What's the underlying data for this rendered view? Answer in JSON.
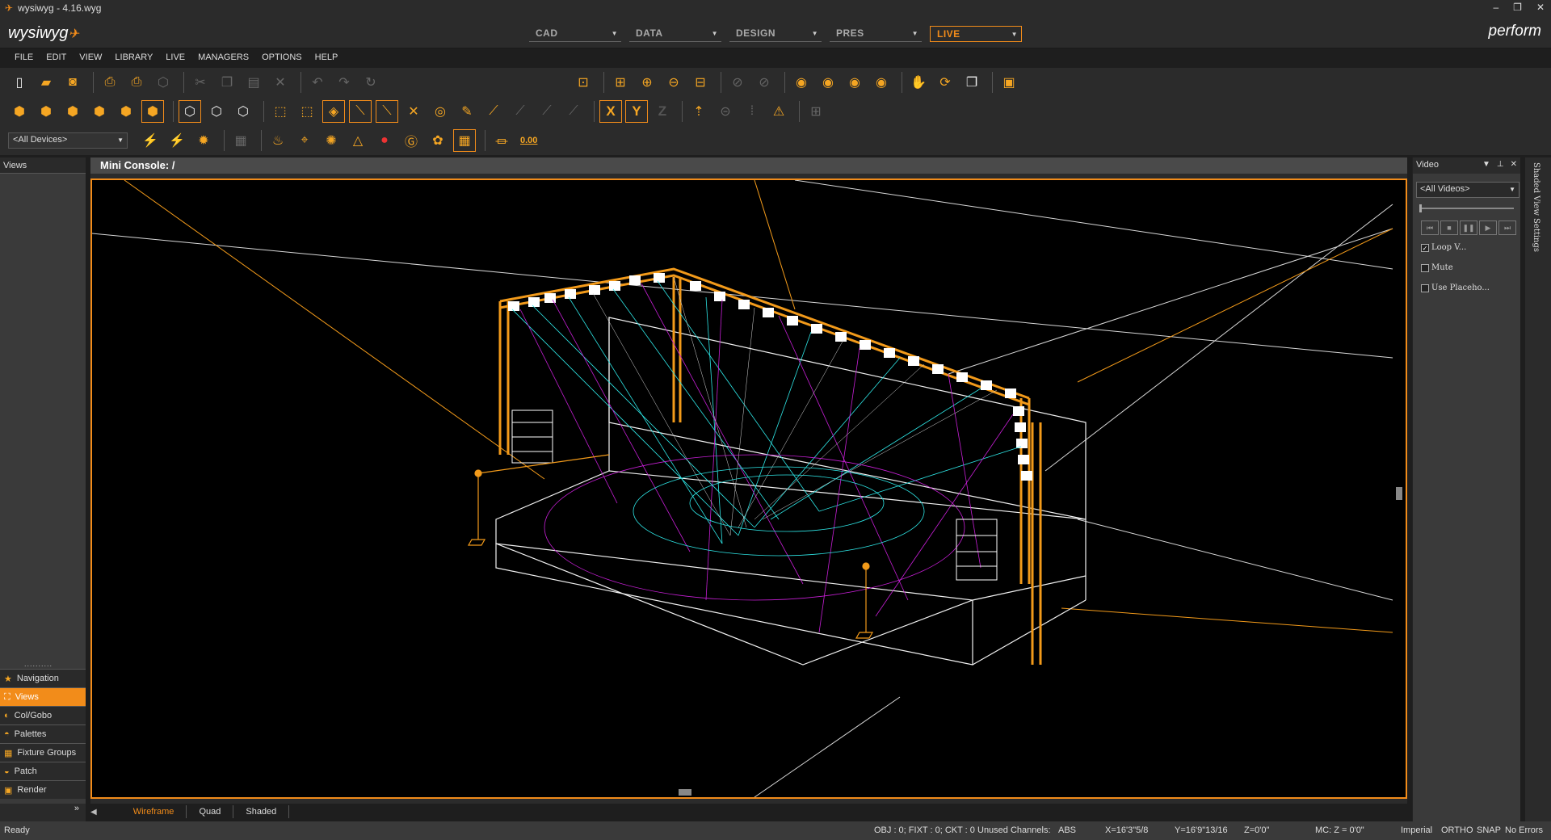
{
  "window": {
    "title": "wysiwyg - 4.16.wyg"
  },
  "brand": {
    "name": "wysiwyg",
    "product": "perform"
  },
  "modes": [
    {
      "label": "CAD",
      "active": false
    },
    {
      "label": "DATA",
      "active": false
    },
    {
      "label": "DESIGN",
      "active": false
    },
    {
      "label": "PRES",
      "active": false
    },
    {
      "label": "LIVE",
      "active": true
    }
  ],
  "menu": [
    "FILE",
    "EDIT",
    "VIEW",
    "LIBRARY",
    "LIVE",
    "MANAGERS",
    "OPTIONS",
    "HELP"
  ],
  "toolbar": {
    "device_filter": "<All Devices>",
    "axis_x": "X",
    "axis_y": "Y",
    "axis_z": "Z",
    "zero_label": "0.00"
  },
  "left_panel": {
    "header": "Views",
    "nav": [
      {
        "label": "Navigation",
        "icon": "star-icon",
        "active": false
      },
      {
        "label": "Views",
        "icon": "views-icon",
        "active": true
      },
      {
        "label": "Col/Gobo",
        "icon": "colgobo-icon",
        "active": false
      },
      {
        "label": "Palettes",
        "icon": "palette-icon",
        "active": false
      },
      {
        "label": "Fixture Groups",
        "icon": "grid-icon",
        "active": false
      },
      {
        "label": "Patch",
        "icon": "patch-icon",
        "active": false
      },
      {
        "label": "Render",
        "icon": "render-icon",
        "active": false
      }
    ],
    "footer": "»"
  },
  "viewport": {
    "title": "Mini Console: /",
    "tabs": [
      {
        "label": "Wireframe",
        "active": true
      },
      {
        "label": "Quad",
        "active": false
      },
      {
        "label": "Shaded",
        "active": false
      }
    ]
  },
  "video_panel": {
    "title": "Video",
    "select": "<All Videos>",
    "loop_label": "Loop V...",
    "loop_checked": true,
    "mute_label": "Mute",
    "mute_checked": false,
    "placeholder_label": "Use Placeho...",
    "placeholder_checked": false,
    "side_tab": "Shaded View Settings"
  },
  "status": {
    "left": "Ready",
    "counts": "OBJ : 0; FIXT : 0; CKT : 0",
    "unused": "Unused Channels:",
    "abs": "ABS",
    "x": "X=16'3\"5/8",
    "y": "Y=16'9\"13/16",
    "z": "Z=0'0\"",
    "mc": "MC: Z = 0'0\"",
    "units": "Imperial",
    "ortho": "ORTHO",
    "snap": "SNAP",
    "errors": "No Errors"
  },
  "colors": {
    "accent": "#f28c1a",
    "truss": "#f29a1a",
    "beam_cyan": "#2ee6e6",
    "beam_magenta": "#c71fd6"
  }
}
